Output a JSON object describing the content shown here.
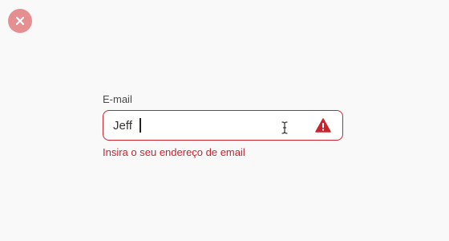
{
  "close": {
    "icon": "close-icon",
    "color": "#e58f91"
  },
  "email_field": {
    "label": "E-mail",
    "value": "Jeff",
    "placeholder": "",
    "state": "error",
    "error_message": "Insira o seu endereço de email",
    "warning_icon": "warning-triangle-icon",
    "error_color": "#c8242f"
  }
}
